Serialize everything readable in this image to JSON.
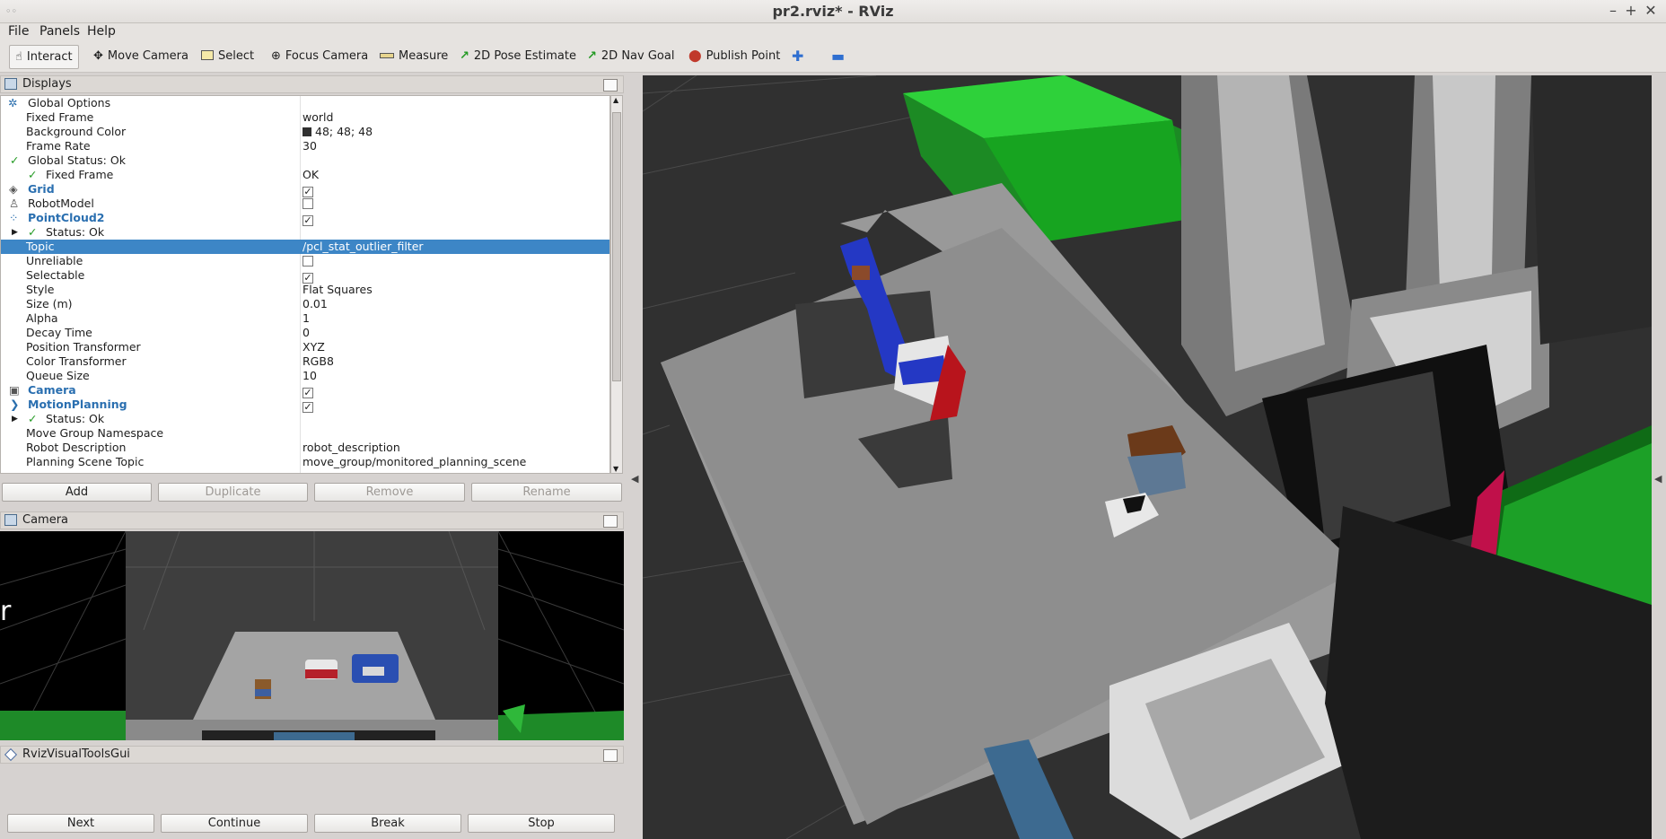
{
  "window": {
    "title": "pr2.rviz* - RViz"
  },
  "menu": [
    "File",
    "Panels",
    "Help"
  ],
  "toolbar": {
    "interact": "Interact",
    "move_camera": "Move Camera",
    "select": "Select",
    "focus_camera": "Focus Camera",
    "measure": "Measure",
    "pose_estimate": "2D Pose Estimate",
    "nav_goal": "2D Nav Goal",
    "publish_point": "Publish Point"
  },
  "displays": {
    "title": "Displays",
    "rows": [
      {
        "key": "Global Options",
        "value": ""
      },
      {
        "key": "Fixed Frame",
        "value": "world"
      },
      {
        "key": "Background Color",
        "value": "48; 48; 48"
      },
      {
        "key": "Frame Rate",
        "value": "30"
      },
      {
        "key": "Global Status: Ok",
        "value": ""
      },
      {
        "key": "Fixed Frame",
        "value": "OK"
      },
      {
        "key": "Grid",
        "value": ""
      },
      {
        "key": "RobotModel",
        "value": ""
      },
      {
        "key": "PointCloud2",
        "value": ""
      },
      {
        "key": "Status: Ok",
        "value": ""
      },
      {
        "key": "Topic",
        "value": "/pcl_stat_outlier_filter"
      },
      {
        "key": "Unreliable",
        "value": ""
      },
      {
        "key": "Selectable",
        "value": ""
      },
      {
        "key": "Style",
        "value": "Flat Squares"
      },
      {
        "key": "Size (m)",
        "value": "0.01"
      },
      {
        "key": "Alpha",
        "value": "1"
      },
      {
        "key": "Decay Time",
        "value": "0"
      },
      {
        "key": "Position Transformer",
        "value": "XYZ"
      },
      {
        "key": "Color Transformer",
        "value": "RGB8"
      },
      {
        "key": "Queue Size",
        "value": "10"
      },
      {
        "key": "Camera",
        "value": ""
      },
      {
        "key": "MotionPlanning",
        "value": ""
      },
      {
        "key": "Status: Ok",
        "value": ""
      },
      {
        "key": "Move Group Namespace",
        "value": ""
      },
      {
        "key": "Robot Description",
        "value": "robot_description"
      },
      {
        "key": "Planning Scene Topic",
        "value": "move_group/monitored_planning_scene"
      }
    ],
    "checks": {
      "grid": true,
      "robotmodel": false,
      "pointcloud2": true,
      "unreliable": false,
      "selectable": true,
      "camera": true,
      "motionplanning": true
    },
    "buttons": {
      "add": "Add",
      "duplicate": "Duplicate",
      "remove": "Remove",
      "rename": "Rename"
    }
  },
  "camera_panel": {
    "title": "Camera",
    "overlay_text": "r"
  },
  "rviz_visual_tools": {
    "title": "RvizVisualToolsGui",
    "buttons": {
      "next": "Next",
      "continue": "Continue",
      "break": "Break",
      "stop": "Stop"
    }
  },
  "colors": {
    "background": "#303030",
    "selection": "#3d86c6",
    "accent_link": "#2a6fb0"
  }
}
